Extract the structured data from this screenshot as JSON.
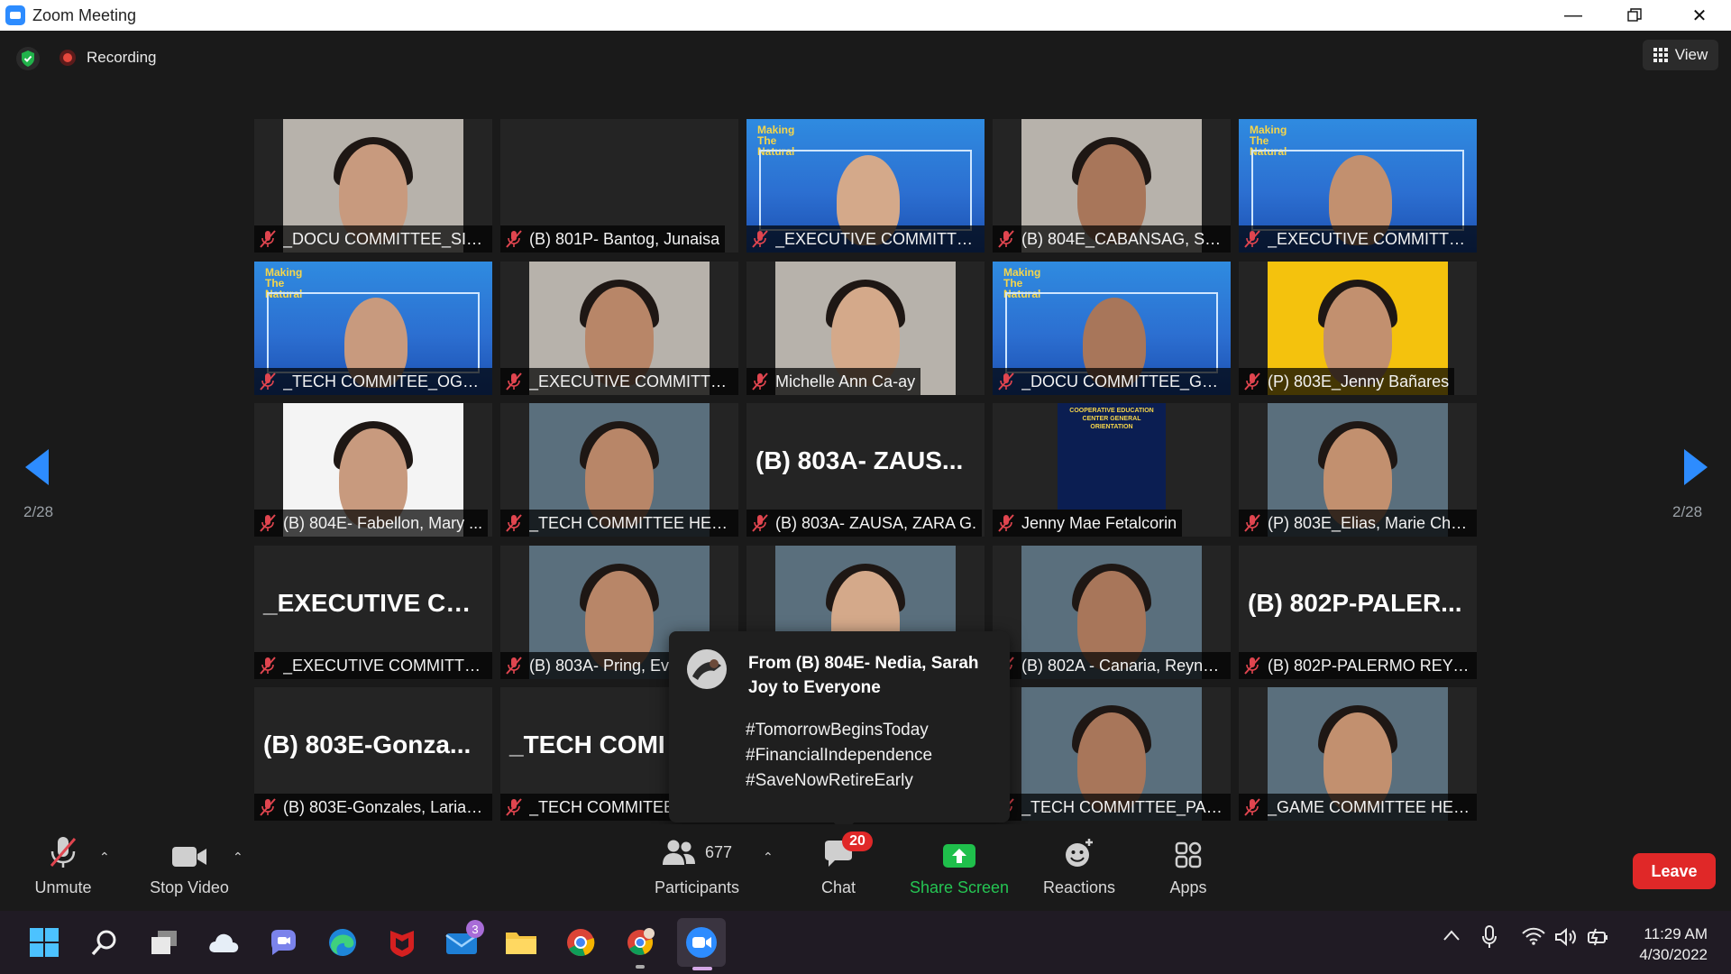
{
  "window": {
    "title": "Zoom Meeting"
  },
  "status": {
    "recording_label": "Recording",
    "view_label": "View"
  },
  "pagination": {
    "left": "2/28",
    "right": "2/28"
  },
  "tiles": [
    {
      "name": "_DOCU COMMITTEE_SIB...",
      "type": "video"
    },
    {
      "name": "(B) 801P- Bantog, Junaisa",
      "type": "blank"
    },
    {
      "name": "_EXECUTIVE COMMITTEE...",
      "type": "banner",
      "banner_text": "Making The Natural"
    },
    {
      "name": "(B) 804E_CABANSAG, SHI...",
      "type": "video"
    },
    {
      "name": "_EXECUTIVE COMMITTEE ...",
      "type": "banner",
      "banner_text": "Making The Natural"
    },
    {
      "name": "_TECH COMMITEE_OGAY...",
      "type": "banner",
      "banner_text": "Making The Natural"
    },
    {
      "name": "_EXECUTIVE COMMITTEE...",
      "type": "video"
    },
    {
      "name": "Michelle Ann Ca-ay",
      "type": "video"
    },
    {
      "name": "_DOCU COMMITTEE_GO...",
      "type": "banner",
      "banner_text": "Making The Natural"
    },
    {
      "name": "(P) 803E_Jenny Bañares",
      "type": "photo"
    },
    {
      "name": "(B) 804E- Fabellon, Mary ...",
      "type": "photo"
    },
    {
      "name": "_TECH COMMITTEE HEAD...",
      "type": "photo"
    },
    {
      "name": "(B) 803A- ZAUSA, ZARA G.",
      "type": "text",
      "display": "(B) 803A- ZAUS..."
    },
    {
      "name": "Jenny Mae Fetalcorin",
      "type": "slide",
      "slide_title": "COOPERATIVE EDUCATION CENTER GENERAL ORIENTATION"
    },
    {
      "name": "(P) 803E_Elias, Marie Chri...",
      "type": "photo"
    },
    {
      "name": "_EXECUTIVE COMMITTEE...",
      "type": "text",
      "display": "_EXECUTIVE CO..."
    },
    {
      "name": "(B) 803A- Pring, Ev",
      "type": "photo"
    },
    {
      "name": "",
      "type": "photo"
    },
    {
      "name": "(B) 802A - Canaria, Reyno...",
      "type": "photo"
    },
    {
      "name": "(B) 802P-PALERMO REY J...",
      "type": "text",
      "display": "(B) 802P-PALER..."
    },
    {
      "name": "(B) 803E-Gonzales, Larian...",
      "type": "text",
      "display": "(B) 803E-Gonza..."
    },
    {
      "name": "_TECH COMMITEE",
      "type": "text",
      "display": "_TECH COMI"
    },
    {
      "name": "",
      "type": "blank"
    },
    {
      "name": "_TECH COMMITTEE_PALIL...",
      "type": "photo"
    },
    {
      "name": "_GAME COMMITTEE HEA...",
      "type": "photo"
    }
  ],
  "chat_popup": {
    "from": "From (B) 804E- Nedia, Sarah Joy to Everyone",
    "lines": [
      "#TomorrowBeginsToday",
      "#FinancialIndependence",
      "#SaveNowRetireEarly"
    ]
  },
  "toolbar": {
    "unmute": "Unmute",
    "stop_video": "Stop Video",
    "participants_count": "677",
    "participants": "Participants",
    "chat": "Chat",
    "chat_badge": "20",
    "share_screen": "Share Screen",
    "reactions": "Reactions",
    "apps": "Apps",
    "leave": "Leave"
  },
  "taskbar": {
    "mail_badge": "3",
    "time": "11:29 AM",
    "date": "4/30/2022"
  },
  "colors": {
    "accent": "#2d8cff",
    "share_green": "#1fbf4b",
    "leave_red": "#e02828",
    "muted_red": "#e0454f"
  }
}
